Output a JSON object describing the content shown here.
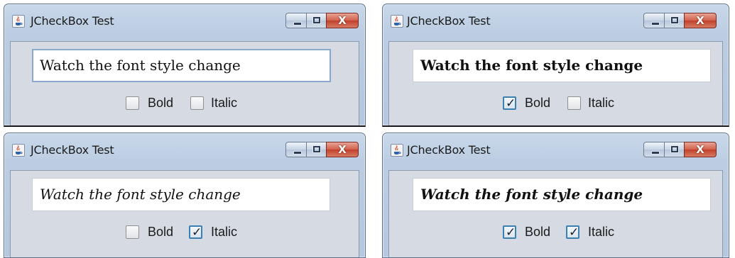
{
  "windows": [
    {
      "id": "top-left",
      "title": "JCheckBox Test",
      "text_field": {
        "value": "Watch the font style change",
        "bold": false,
        "italic": false,
        "focused": true
      },
      "bold_checkbox": {
        "label": "Bold",
        "checked": false
      },
      "italic_checkbox": {
        "label": "Italic",
        "checked": false
      },
      "close_glyph": "X"
    },
    {
      "id": "top-right",
      "title": "JCheckBox Test",
      "text_field": {
        "value": "Watch the font style change",
        "bold": true,
        "italic": false,
        "focused": false
      },
      "bold_checkbox": {
        "label": "Bold",
        "checked": true
      },
      "italic_checkbox": {
        "label": "Italic",
        "checked": false
      },
      "close_glyph": "X"
    },
    {
      "id": "bottom-left",
      "title": "JCheckBox Test",
      "text_field": {
        "value": "Watch the font style change",
        "bold": false,
        "italic": true,
        "focused": false
      },
      "bold_checkbox": {
        "label": "Bold",
        "checked": false
      },
      "italic_checkbox": {
        "label": "Italic",
        "checked": true
      },
      "close_glyph": "X"
    },
    {
      "id": "bottom-right",
      "title": "JCheckBox Test",
      "text_field": {
        "value": "Watch the font style change",
        "bold": true,
        "italic": true,
        "focused": false
      },
      "bold_checkbox": {
        "label": "Bold",
        "checked": true
      },
      "italic_checkbox": {
        "label": "Italic",
        "checked": true
      },
      "close_glyph": "X"
    }
  ],
  "icons": {
    "app_icon": "java-cup-icon",
    "minimize": "minimize-icon",
    "maximize": "maximize-icon",
    "close": "close-icon",
    "check": "checkmark-icon"
  },
  "colors": {
    "title_bar": "#bccde3",
    "client_area": "#d5dae3",
    "close_button": "#c1402b",
    "checkbox_checked_border": "#3c7fb1",
    "focus_border": "#8aa8cc"
  }
}
